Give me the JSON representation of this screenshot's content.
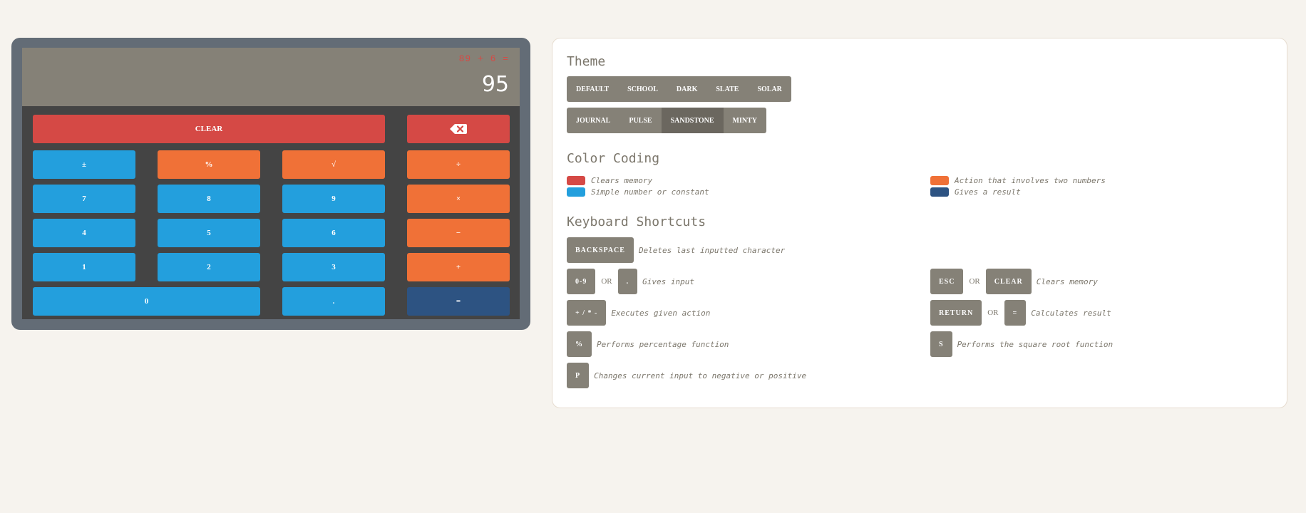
{
  "calculator": {
    "expression": "89 + 6 =",
    "result": "95",
    "keys": {
      "clear": "CLEAR",
      "backspace_icon": "backspace-icon",
      "negate": "±",
      "percent": "%",
      "sqrt": "√",
      "divide": "÷",
      "seven": "7",
      "eight": "8",
      "nine": "9",
      "multiply": "×",
      "four": "4",
      "five": "5",
      "six": "6",
      "minus": "−",
      "one": "1",
      "two": "2",
      "three": "3",
      "plus": "+",
      "zero": "0",
      "decimal": ".",
      "equals": "="
    }
  },
  "colors": {
    "clear_red": "#d54945",
    "number_blue": "#239fdd",
    "action_orange": "#f07137",
    "result_navy": "#2d5382",
    "calc_frame": "#636c76",
    "screen": "#858177"
  },
  "panel": {
    "theme_heading": "Theme",
    "themes_row1": [
      "DEFAULT",
      "SCHOOL",
      "DARK",
      "SLATE",
      "SOLAR"
    ],
    "themes_row2": [
      "JOURNAL",
      "PULSE",
      "SANDSTONE",
      "MINTY"
    ],
    "active_theme": "SANDSTONE",
    "color_heading": "Color Coding",
    "legend": {
      "clears": "Clears memory",
      "simple": "Simple number or constant",
      "action": "Action that involves two numbers",
      "result": "Gives a result"
    },
    "shortcuts_heading": "Keyboard Shortcuts",
    "or": "OR",
    "shortcuts": {
      "backspace_key": "BACKSPACE",
      "backspace_desc": "Deletes last inputted character",
      "digits_key": "0-9",
      "dot_key": ".",
      "input_desc": "Gives input",
      "esc_key": "ESC",
      "clear_key": "CLEAR",
      "clear_desc": "Clears memory",
      "ops_key": "+ / * -",
      "ops_desc": "Executes given action",
      "return_key": "RETURN",
      "equals_key": "=",
      "calc_desc": "Calculates result",
      "pct_key": "%",
      "pct_desc": "Performs percentage function",
      "s_key": "S",
      "s_desc": "Performs the square root function",
      "p_key": "P",
      "p_desc": "Changes current input to negative or positive"
    }
  }
}
